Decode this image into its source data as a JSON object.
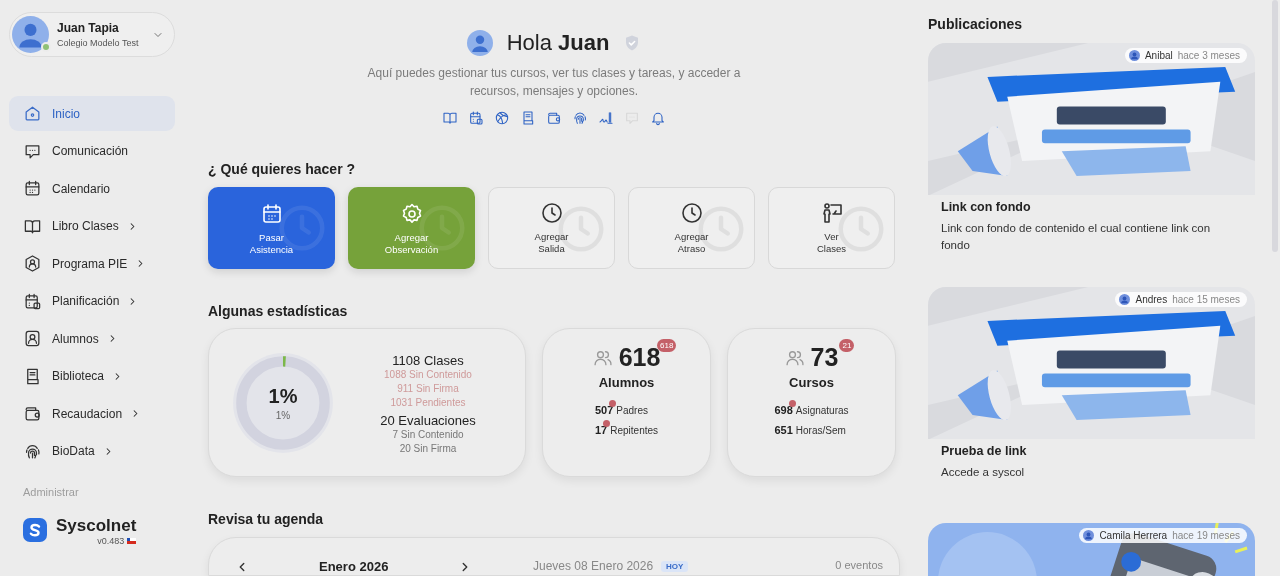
{
  "profile": {
    "name": "Juan Tapia",
    "school": "Colegio Modelo Test",
    "online": true
  },
  "sidebar": {
    "items": [
      {
        "label": "Inicio",
        "selected": true,
        "expandable": false
      },
      {
        "label": "Comunicación",
        "selected": false,
        "expandable": false
      },
      {
        "label": "Calendario",
        "selected": false,
        "expandable": false
      },
      {
        "label": "Libro Clases",
        "selected": false,
        "expandable": true
      },
      {
        "label": "Programa PIE",
        "selected": false,
        "expandable": true
      },
      {
        "label": "Planificación",
        "selected": false,
        "expandable": true
      },
      {
        "label": "Alumnos",
        "selected": false,
        "expandable": true
      },
      {
        "label": "Biblioteca",
        "selected": false,
        "expandable": true
      },
      {
        "label": "Recaudacion",
        "selected": false,
        "expandable": true
      },
      {
        "label": "BioData",
        "selected": false,
        "expandable": true
      }
    ],
    "section_label": "Administrar",
    "brand": "Syscolnet",
    "version": "v0.483"
  },
  "greeting": {
    "text": "Hola **Juan**",
    "verified": true,
    "subtitle": "Aquí puedes gestionar tus cursos, ver tus clases y tareas, y acceder a recursos, mensajes y opciones.",
    "shortcuts": [
      {
        "disabled": false
      },
      {
        "disabled": false
      },
      {
        "disabled": false
      },
      {
        "disabled": false
      },
      {
        "disabled": false
      },
      {
        "disabled": false
      },
      {
        "disabled": false
      },
      {
        "disabled": true
      },
      {
        "disabled": false
      }
    ]
  },
  "actions": {
    "title": "¿ Qué quieres hacer ?",
    "items": [
      {
        "label": "Pasar Asistencia",
        "kind": "filled",
        "color": "#2a64dc"
      },
      {
        "label": "Agregar Observación",
        "kind": "filled",
        "color": "#76a23a"
      },
      {
        "label": "Agregar Salida",
        "kind": "outline"
      },
      {
        "label": "Agregar Atraso",
        "kind": "outline"
      },
      {
        "label": "Ver Clases",
        "kind": "outline"
      }
    ]
  },
  "stats": {
    "title": "Algunas estadísticas",
    "progress": {
      "level": 0.01,
      "value": "1%",
      "caption": "1%",
      "groups": [
        {
          "heading": "1108 Clases",
          "alert": true,
          "lines": [
            "1088 Sin Contenido",
            "911 Sin Firma",
            "1031 Pendientes"
          ]
        },
        {
          "heading": "20 Evaluaciones",
          "alert": false,
          "lines": [
            "7 Sin Contenido",
            "20 Sin Firma"
          ]
        }
      ]
    },
    "counters": [
      {
        "count": "618",
        "badge": "618",
        "label": "Alumnos",
        "lines": [
          {
            "value": "507",
            "label": "Padres",
            "alert": true
          },
          {
            "value": "17",
            "label": "Repitentes",
            "alert": true
          }
        ]
      },
      {
        "count": "73",
        "badge": "21",
        "label": "Cursos",
        "lines": [
          {
            "value": "698",
            "label": "Asignaturas",
            "alert": true
          },
          {
            "value": "651",
            "label": "Horas/Sem",
            "alert": false
          }
        ]
      }
    ]
  },
  "agenda": {
    "title": "Revisa tu agenda",
    "month": "Enero 2026",
    "date": "Jueves 08 Enero 2026",
    "today_badge": "HOY",
    "events": "0 eventos"
  },
  "publications": {
    "title": "Publicaciones",
    "items": [
      {
        "kind": "picture",
        "author": "Anibal",
        "time": "hace 3 meses",
        "title": "Link con fondo",
        "body": "Link con fondo de contenido el cual contiene link con fondo"
      },
      {
        "kind": "picture",
        "author": "Andres",
        "time": "hace 15 meses",
        "title": "Prueba de link",
        "body": "Accede a syscol"
      },
      {
        "kind": "picture",
        "author": "Camila Herrera",
        "time": "hace 19 meses"
      }
    ]
  }
}
